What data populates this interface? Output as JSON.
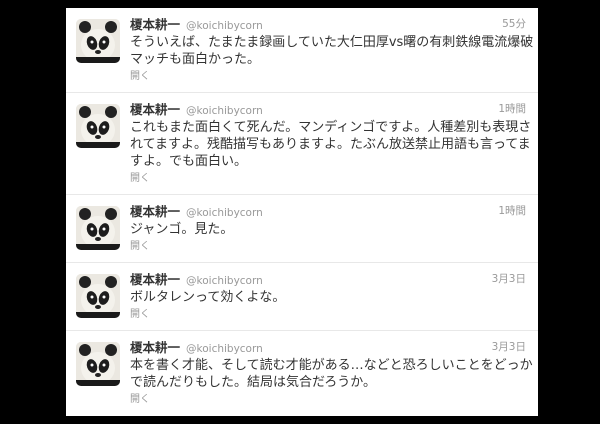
{
  "tweets": [
    {
      "name": "榎本耕一",
      "handle": "@koichibycorn",
      "time": "55分",
      "lines": [
        "そういえば、たまたま録画していた大仁田厚vs曙の有刺鉄線電流爆破",
        "マッチも面白かった。"
      ],
      "open": "開く"
    },
    {
      "name": "榎本耕一",
      "handle": "@koichibycorn",
      "time": "1時間",
      "lines": [
        "これもまた面白くて死んだ。マンディンゴですよ。人種差別も表現さ",
        "れてますよ。残酷描写もありますよ。たぶん放送禁止用語も言ってま",
        "すよ。でも面白い。"
      ],
      "open": "開く"
    },
    {
      "name": "榎本耕一",
      "handle": "@koichibycorn",
      "time": "1時間",
      "lines": [
        "ジャンゴ。見た。"
      ],
      "open": "開く"
    },
    {
      "name": "榎本耕一",
      "handle": "@koichibycorn",
      "time": "3月3日",
      "lines": [
        "ボルタレンって効くよな。"
      ],
      "open": "開く"
    },
    {
      "name": "榎本耕一",
      "handle": "@koichibycorn",
      "time": "3月3日",
      "lines": [
        "本を書く才能、そして読む才能がある…などと恐ろしいことをどっか",
        "で読んだりもした。結局は気合だろうか。"
      ],
      "open": "開く"
    }
  ]
}
